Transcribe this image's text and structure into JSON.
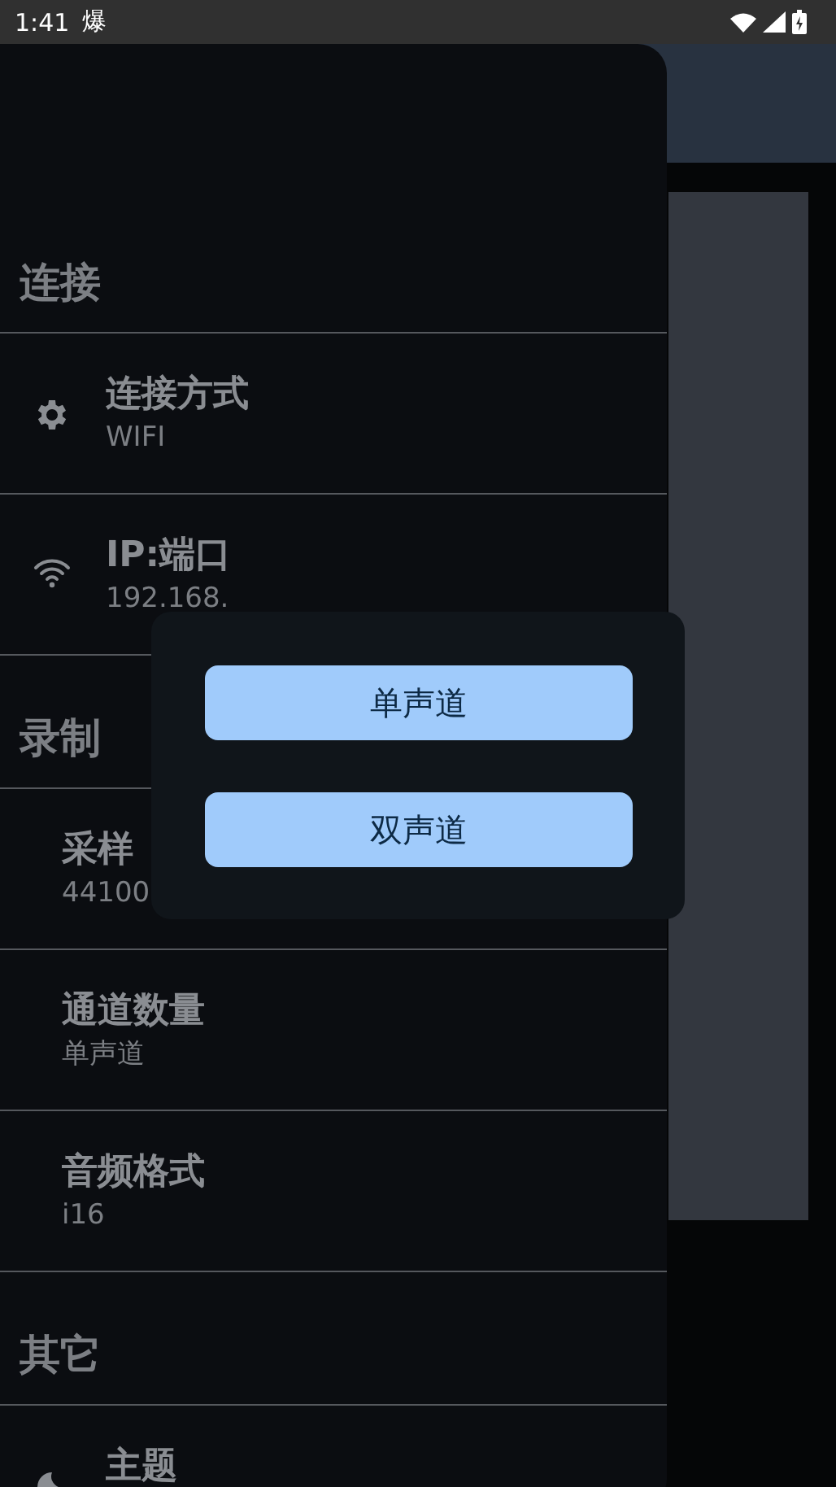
{
  "status_bar": {
    "time": "1:41",
    "notification": "爆"
  },
  "sections": [
    {
      "title": "连接",
      "items": [
        {
          "kind": "gear",
          "title": "连接方式",
          "value": "WIFI"
        },
        {
          "kind": "wifi",
          "title": "IP:端口",
          "value": "192.168."
        }
      ]
    },
    {
      "title": "录制",
      "items": [
        {
          "kind": "plain",
          "title": "采样",
          "value": "44100"
        },
        {
          "kind": "plain",
          "title": "通道数量",
          "value": "单声道"
        },
        {
          "kind": "plain",
          "title": "音频格式",
          "value": "i16"
        }
      ]
    },
    {
      "title": "其它",
      "items": [
        {
          "kind": "moon",
          "title": "主题"
        }
      ]
    }
  ],
  "dialog": {
    "options": [
      "单声道",
      "双声道"
    ]
  }
}
